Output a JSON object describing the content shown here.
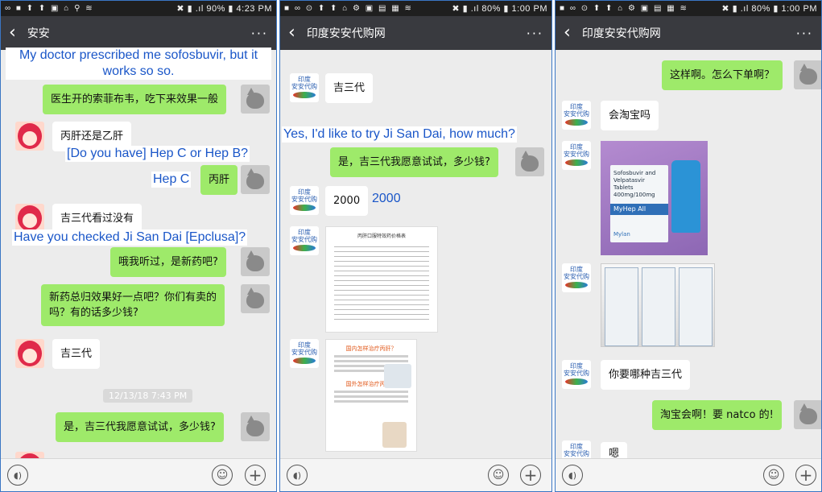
{
  "panel1": {
    "status_left": "∞ ■ ⬆ ⬆ ▣ ⌂ ⚲ ≋",
    "status_right": "✖ ▮ .ıl 90% ▮ 4:23 PM",
    "title": "安安",
    "more": "···",
    "caption_top": "My doctor prescribed me sofosbuvir, but it works so so.",
    "msg1": "医生开的索菲布韦，吃下来效果一般",
    "msg2": "丙肝还是乙肝",
    "caption2": "[Do you have] Hep C or Hep B?",
    "caption3": "Hep C",
    "msg3": "丙肝",
    "msg4": "吉三代看过没有",
    "caption4": "Have you checked Ji San Dai [Epclusa]?",
    "msg5": "哦我听过，是新药吧?",
    "msg6_line1": "新药总归效果好一点吧？你们有卖的",
    "msg6_line2": "吗？有的话多少钱?",
    "msg7": "吉三代",
    "timestamp": "12/13/18 7:43 PM",
    "msg8": "是，吉三代我愿意试试，多少钱?"
  },
  "panel2": {
    "status_left": "■ ∞ ⊙ ⬆ ⬆ ⌂ ⚙ ▣ ▤ ▦ ≋",
    "status_right": "✖ ▮ .ıl 80% ▮ 1:00 PM",
    "title": "印度安安代购网",
    "more": "···",
    "msg1": "吉三代",
    "caption1": "Yes, I'd like to try Ji San Dai, how much?",
    "msg2": "是，吉三代我愿意试试，多少钱?",
    "msg3": "2000",
    "caption3": "2000",
    "doc_title": "丙肝口服特效药价格表",
    "flyer_title1": "国内怎样治疗丙肝？",
    "flyer_title2": "国外怎样治疗丙肝？"
  },
  "panel3": {
    "status_left": "■ ∞ ⊙ ⬆ ⬆ ⌂ ⚙ ▣ ▤ ▦ ≋",
    "status_right": "✖ ▮ .ıl 80% ▮ 1:00 PM",
    "title": "印度安安代购网",
    "more": "···",
    "msg1": "这样啊。怎么下单啊？",
    "msg2": "会淘宝吗",
    "photo1_label": "Sofosbuvir and Velpatasvir Tablets 400mg/100mg",
    "photo1_brand": "MyHep All",
    "photo1_maker": "Mylan",
    "msg3": "你要哪种吉三代",
    "msg4": "淘宝会啊！要 natco 的!",
    "msg5": "嗯"
  },
  "logo_text": "印度\n安安代购"
}
